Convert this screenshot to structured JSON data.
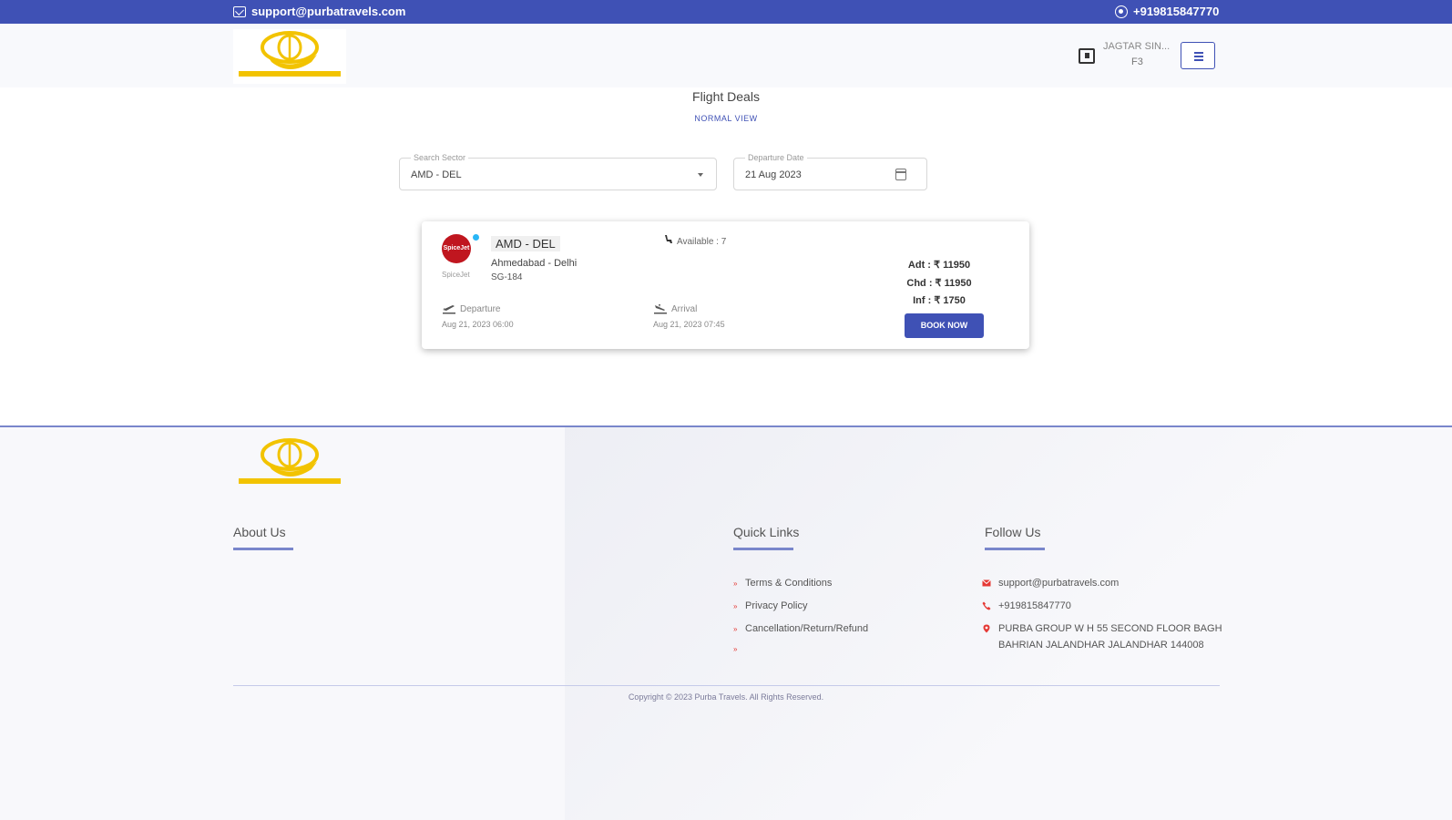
{
  "topbar": {
    "email": "support@purbatravels.com",
    "phone": "+919815847770"
  },
  "header": {
    "user_name": "JAGTAR SIN...",
    "user_sub": "F3"
  },
  "main": {
    "title": "Flight Deals",
    "view_link": "NORMAL VIEW",
    "search_sector": {
      "label": "Search Sector",
      "value": "AMD - DEL"
    },
    "departure_date": {
      "label": "Departure Date",
      "value": "21 Aug 2023"
    }
  },
  "flight": {
    "airline_logo_text": "SpiceJet",
    "airline_name": "SpiceJet",
    "route_code": "AMD - DEL",
    "route_city": "Ahmedabad - Delhi",
    "flight_no": "SG-184",
    "available": "Available : 7",
    "departure_label": "Departure",
    "departure_time": "Aug 21, 2023 06:00",
    "arrival_label": "Arrival",
    "arrival_time": "Aug 21, 2023 07:45",
    "fare_adult": "Adt : ₹ 11950",
    "fare_child": "Chd : ₹ 11950",
    "fare_infant": "Inf : ₹ 1750",
    "book_label": "BOOK NOW"
  },
  "footer": {
    "about_heading": "About Us",
    "quick_heading": "Quick Links",
    "follow_heading": "Follow Us",
    "links": [
      "Terms & Conditions",
      "Privacy Policy",
      "Cancellation/Return/Refund",
      ""
    ],
    "contact_email": "support@purbatravels.com",
    "contact_phone": "+919815847770",
    "contact_address": "PURBA GROUP W H 55 SECOND FLOOR BAGH BAHRIAN JALANDHAR JALANDHAR 144008",
    "copyright": "Copyright © 2023 Purba Travels. All Rights Reserved."
  },
  "colors": {
    "primary": "#3f51b5",
    "accent_red": "#e53935",
    "logo_gold": "#f2c300"
  }
}
